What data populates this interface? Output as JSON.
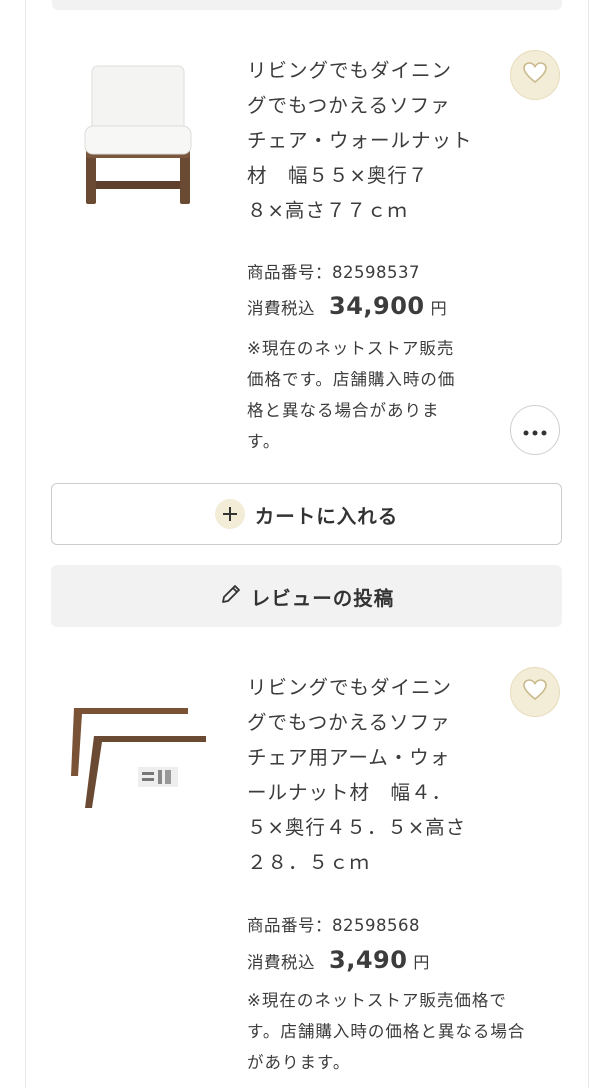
{
  "products": [
    {
      "title": "リビングでもダイニン\nグでもつかえるソファ\nチェア・ウォールナット\n材　幅５５×奥行７\n８×高さ７７ｃｍ",
      "product_number": "商品番号：82598537",
      "price_label": "消費税込",
      "price": "34,900",
      "price_unit": "円",
      "note": "※現在のネットストア販売\n価格です。店舗購入時の価\n格と異なる場合がありま\nす。",
      "image": "sofa-chair-walnut"
    },
    {
      "title": "リビングでもダイニン\nグでもつかえるソファ\nチェア用アーム・ウォ\nールナット材　幅４．\n５×奥行４５．５×高さ\n２８．５ｃｍ",
      "product_number": "商品番号：82598568",
      "price_label": "消費税込",
      "price": "3,490",
      "price_unit": "円",
      "note": "※現在のネットストア販売価格で\nす。店舗購入時の価格と異なる場合\nがあります。",
      "image": "chair-arms-walnut"
    }
  ],
  "actions": {
    "add_to_cart": "カートに入れる",
    "write_review": "レビューの投稿"
  },
  "icons": {
    "favorite": "heart-icon",
    "more": "more-horizontal-icon",
    "add": "plus-icon",
    "review": "pencil-icon"
  },
  "colors": {
    "accent_bg": "#f3ecd6",
    "text": "#3c3c3c",
    "walnut": "#6b4a33"
  }
}
